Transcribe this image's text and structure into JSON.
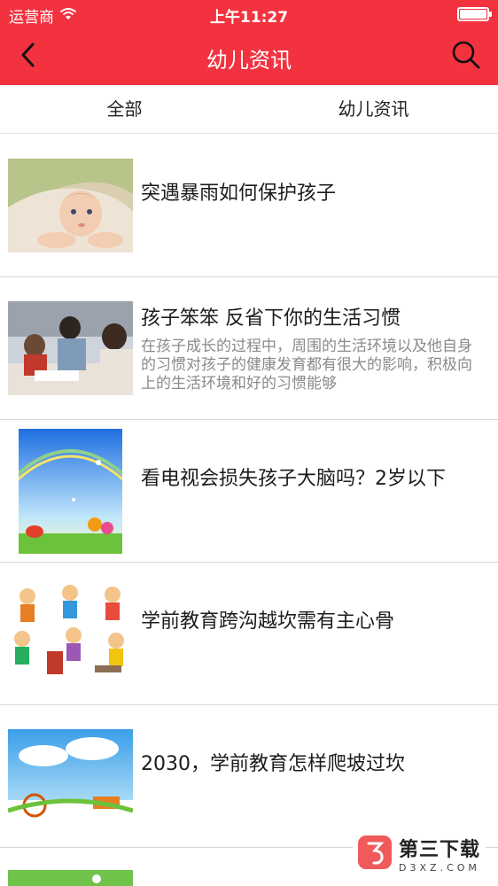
{
  "status_bar": {
    "carrier": "运营商",
    "time": "上午11:27",
    "battery_level": 0.95
  },
  "navbar": {
    "title": "幼儿资讯",
    "back_icon": "chevron-left-icon",
    "search_icon": "search-icon"
  },
  "tabs": [
    {
      "label": "全部"
    },
    {
      "label": "幼儿资讯"
    }
  ],
  "articles": [
    {
      "title": "突遇暴雨如何保护孩子",
      "summary": ""
    },
    {
      "title": "孩子笨笨 反省下你的生活习惯",
      "summary": "在孩子成长的过程中，周围的生活环境以及他自身的习惯对孩子的健康发育都有很大的影响，积极向上的生活环境和好的习惯能够"
    },
    {
      "title": "看电视会损失孩子大脑吗？2岁以下",
      "summary": ""
    },
    {
      "title": "学前教育跨沟越坎需有主心骨",
      "summary": ""
    },
    {
      "title": "2030，学前教育怎样爬坡过坎",
      "summary": ""
    }
  ],
  "watermark": {
    "name": "第三下载",
    "domain": "D3XZ.COM"
  },
  "colors": {
    "brand_red": "#f3323f"
  }
}
